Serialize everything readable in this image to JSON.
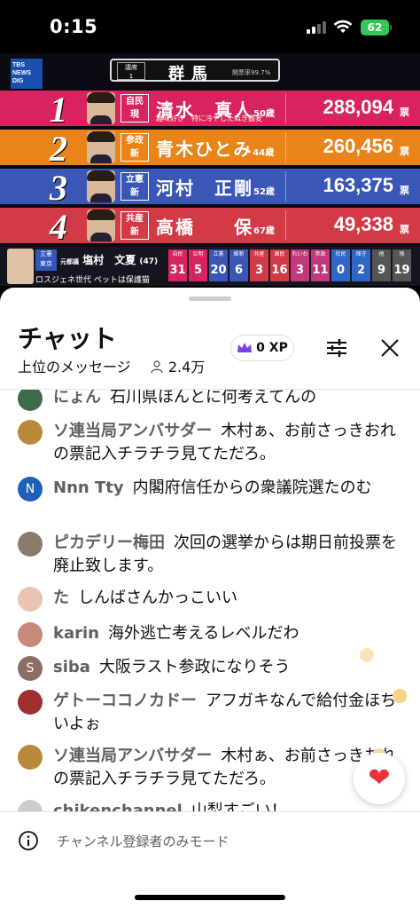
{
  "status_bar": {
    "time": "0:15",
    "battery": "62"
  },
  "broadcast": {
    "logo": [
      "TBS",
      "NEWS",
      "DIG"
    ],
    "seats_label": "議席",
    "seats_value": "1",
    "prefecture": "群馬",
    "count_rate": "開票率99.7%",
    "winner_mark": "当",
    "candidates": [
      {
        "rank": "1",
        "party": "自民",
        "status": "現",
        "name": "清水　真人",
        "age": "50歳",
        "note": "趣味好き　特に冷やしたぬき蕎麦",
        "votes": "288,094",
        "unit": "票"
      },
      {
        "rank": "2",
        "party": "参政",
        "status": "新",
        "name": "青木ひとみ",
        "age": "44歳",
        "note": "",
        "votes": "260,456",
        "unit": "票"
      },
      {
        "rank": "3",
        "party": "立憲",
        "status": "新",
        "name": "河村　正剛",
        "age": "52歳",
        "note": "",
        "votes": "163,375",
        "unit": "票"
      },
      {
        "rank": "4",
        "party": "共産",
        "status": "新",
        "name": "高橋　　保",
        "age": "67歳",
        "note": "",
        "votes": "49,338",
        "unit": "票"
      }
    ],
    "ticker": {
      "party": "立憲",
      "region": "東京",
      "tag": "元都議",
      "name": "塩村　文夏",
      "age": "(47)",
      "note": "ロスジェネ世代 ペットは保護猫"
    },
    "seat_counts": [
      {
        "party": "自民",
        "a": "31",
        "b": "5",
        "color": "#d8245e",
        "label2": "公明"
      },
      {
        "party": "立憲",
        "a": "20",
        "b": "6",
        "color": "#3a56b6",
        "label2": "維新"
      },
      {
        "party": "共産",
        "a": "3",
        "b": "16",
        "color": "#d23a45",
        "label2": "国民"
      },
      {
        "party": "れいわ",
        "a": "3",
        "b": "11",
        "color": "#c2387a",
        "label2": "参政"
      },
      {
        "party": "社民",
        "a": "0",
        "b": "2",
        "color": "#2f67c8",
        "label2": "保守"
      },
      {
        "party": "他",
        "a": "9",
        "b": "19",
        "color": "#555555",
        "label2": "残"
      }
    ]
  },
  "chat": {
    "title": "チャット",
    "subtitle": "上位のメッセージ",
    "viewers": "2.4万",
    "xp": "0 XP",
    "messages": [
      {
        "author": "にょん",
        "text": "石川県ほんとに何考えてんの",
        "avatar_color": "#3f6b4a",
        "avatar_letter": ""
      },
      {
        "author": "ソ連当局アンバサダー",
        "text": "木村ぁ、お前さっきおれの票記入チラチラ見てただろ。",
        "avatar_color": "#b8893a",
        "avatar_letter": ""
      },
      {
        "author": "Nnn Tty",
        "text": "内閣府信任からの衆議院選たのむ",
        "avatar_color": "#1e5fb8",
        "avatar_letter": "N"
      },
      {
        "author": "ピカデリー梅田",
        "text": "次回の選挙からは期日前投票を廃止致します。",
        "avatar_color": "#8a7a6a",
        "avatar_letter": ""
      },
      {
        "author": "た",
        "text": "しんばさんかっこいい",
        "avatar_color": "#e9c3b3",
        "avatar_letter": ""
      },
      {
        "author": "karin",
        "text": "海外逃亡考えるレベルだわ",
        "avatar_color": "#c48a7a",
        "avatar_letter": ""
      },
      {
        "author": "siba",
        "text": "大阪ラスト参政になりそう",
        "avatar_color": "#8d6e63",
        "avatar_letter": "S"
      },
      {
        "author": "ゲトーココノカドー",
        "text": "アフガキなんで給付金ほちいよぉ",
        "avatar_color": "#a03030",
        "avatar_letter": ""
      },
      {
        "author": "ソ連当局アンバサダー",
        "text": "木村ぁ、お前さっきおれの票記入チラチラ見てただろ。",
        "avatar_color": "#b8893a",
        "avatar_letter": ""
      },
      {
        "author": "chikenchannel",
        "text": "山梨すごい！",
        "avatar_color": "#cccccc",
        "avatar_letter": ""
      }
    ],
    "footer": "チャンネル登録者のみモード"
  },
  "colors": {
    "like": "#e8323c",
    "xp_icon": "#7b3fe4"
  }
}
